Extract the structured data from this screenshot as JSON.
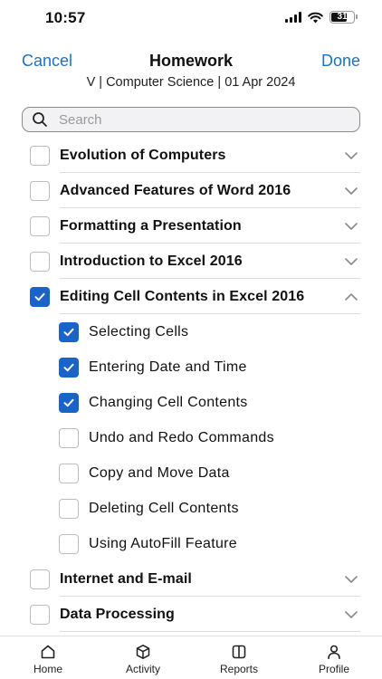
{
  "status": {
    "time": "10:57",
    "battery": "31"
  },
  "header": {
    "cancel_label": "Cancel",
    "title": "Homework",
    "done_label": "Done",
    "subtitle": "V | Computer Science | 01 Apr 2024"
  },
  "search": {
    "placeholder": "Search"
  },
  "topics": [
    {
      "label": "Evolution of Computers",
      "checked": false,
      "expanded": false
    },
    {
      "label": "Advanced Features of Word 2016",
      "checked": false,
      "expanded": false
    },
    {
      "label": "Formatting a Presentation",
      "checked": false,
      "expanded": false
    },
    {
      "label": "Introduction to Excel 2016",
      "checked": false,
      "expanded": false
    },
    {
      "label": "Editing Cell Contents in Excel 2016",
      "checked": true,
      "expanded": true,
      "subtopics": [
        {
          "label": "Selecting Cells",
          "checked": true
        },
        {
          "label": "Entering Date and Time",
          "checked": true
        },
        {
          "label": "Changing Cell Contents",
          "checked": true
        },
        {
          "label": "Undo and Redo Commands",
          "checked": false
        },
        {
          "label": "Copy and Move Data",
          "checked": false
        },
        {
          "label": "Deleting Cell Contents",
          "checked": false
        },
        {
          "label": "Using AutoFill Feature",
          "checked": false
        }
      ]
    },
    {
      "label": "Internet and E-mail",
      "checked": false,
      "expanded": false
    },
    {
      "label": "Data Processing",
      "checked": false,
      "expanded": false
    }
  ],
  "tabbar": {
    "home": "Home",
    "activity": "Activity",
    "reports": "Reports",
    "profile": "Profile"
  },
  "colors": {
    "accent": "#1a73c8",
    "checkbox_checked": "#1a63c9"
  }
}
